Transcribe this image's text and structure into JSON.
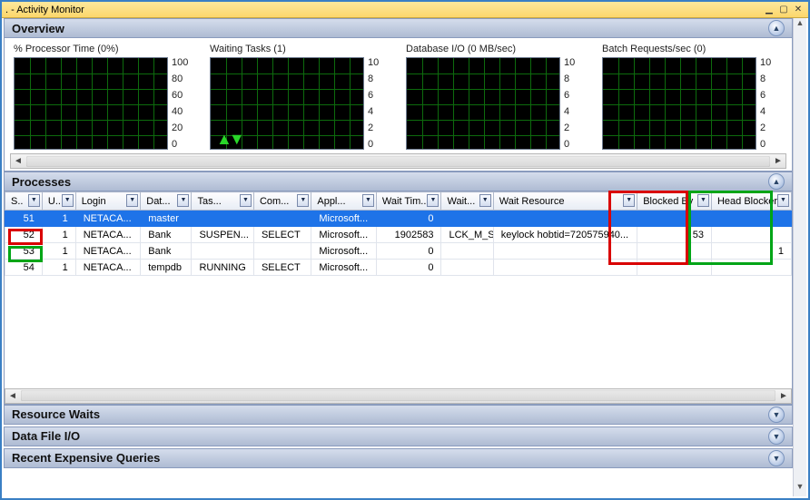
{
  "window": {
    "title": ". - Activity Monitor"
  },
  "sections": {
    "overview": "Overview",
    "processes": "Processes",
    "resourceWaits": "Resource Waits",
    "dataFileIO": "Data File I/O",
    "expensive": "Recent Expensive Queries"
  },
  "charts": [
    {
      "title": "% Processor Time (0%)",
      "ticks": [
        "100",
        "80",
        "60",
        "40",
        "20",
        "0"
      ],
      "spike": false
    },
    {
      "title": "Waiting Tasks (1)",
      "ticks": [
        "10",
        "8",
        "6",
        "4",
        "2",
        "0"
      ],
      "spike": true
    },
    {
      "title": "Database I/O (0 MB/sec)",
      "ticks": [
        "10",
        "8",
        "6",
        "4",
        "2",
        "0"
      ],
      "spike": false
    },
    {
      "title": "Batch Requests/sec (0)",
      "ticks": [
        "10",
        "8",
        "6",
        "4",
        "2",
        "0"
      ],
      "spike": false
    }
  ],
  "columns": [
    "S..",
    "U..",
    "Login",
    "Dat...",
    "Tas...",
    "Com...",
    "Appl...",
    "Wait Tim...",
    "Wait...",
    "Wait Resource",
    "Blocked By",
    "Head Blocker"
  ],
  "rows": [
    {
      "sid": "51",
      "u": "1",
      "login": "NETACA...",
      "db": "master",
      "task": "",
      "cmd": "",
      "app": "Microsoft...",
      "wt": "0",
      "wty": "",
      "wres": "",
      "bby": "",
      "hb": "",
      "sel": true
    },
    {
      "sid": "52",
      "u": "1",
      "login": "NETACA...",
      "db": "Bank",
      "task": "SUSPEN...",
      "cmd": "SELECT",
      "app": "Microsoft...",
      "wt": "1902583",
      "wty": "LCK_M_S",
      "wres": "keylock hobtid=720575940...",
      "bby": "53",
      "hb": ""
    },
    {
      "sid": "53",
      "u": "1",
      "login": "NETACA...",
      "db": "Bank",
      "task": "",
      "cmd": "",
      "app": "Microsoft...",
      "wt": "0",
      "wty": "",
      "wres": "",
      "bby": "",
      "hb": "1"
    },
    {
      "sid": "54",
      "u": "1",
      "login": "NETACA...",
      "db": "tempdb",
      "task": "RUNNING",
      "cmd": "SELECT",
      "app": "Microsoft...",
      "wt": "0",
      "wty": "",
      "wres": "",
      "bby": "",
      "hb": ""
    }
  ],
  "chart_data": [
    {
      "type": "line",
      "title": "% Processor Time",
      "current": 0,
      "ylim": [
        0,
        100
      ],
      "values": []
    },
    {
      "type": "line",
      "title": "Waiting Tasks",
      "current": 1,
      "ylim": [
        0,
        10
      ],
      "values": [
        1
      ]
    },
    {
      "type": "line",
      "title": "Database I/O (MB/sec)",
      "current": 0,
      "ylim": [
        0,
        10
      ],
      "values": []
    },
    {
      "type": "line",
      "title": "Batch Requests/sec",
      "current": 0,
      "ylim": [
        0,
        10
      ],
      "values": []
    }
  ]
}
